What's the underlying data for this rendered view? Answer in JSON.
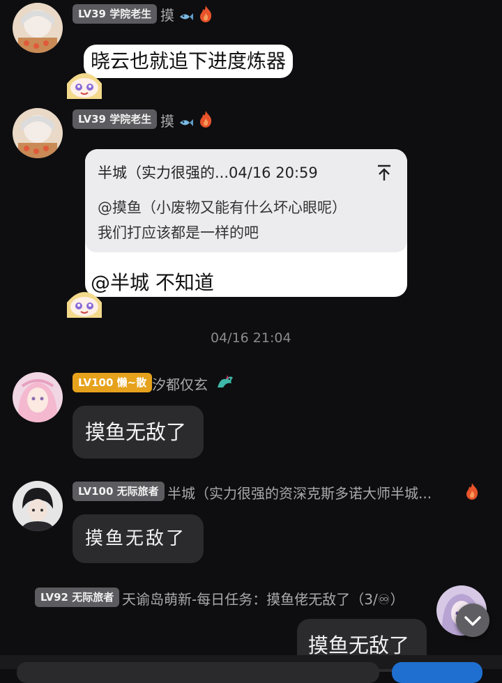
{
  "messages": [
    {
      "level_badge": "LV39 学院老生",
      "nickname": "摸",
      "text": "晓云也就追下进度炼器"
    },
    {
      "level_badge": "LV39 学院老生",
      "nickname": "摸",
      "quote": {
        "header": "半城（实力很强的...04/16 20:59",
        "line1": "@摸鱼（小废物又能有什么坏心眼呢）",
        "line2": "我们打应该都是一样的吧"
      },
      "text": "@半城 不知道"
    }
  ],
  "timestamp": "04/16 21:04",
  "messages2": [
    {
      "level_badge": "LV100 懒~散",
      "nickname": "汐都仅玄",
      "text": "摸鱼无敌了"
    },
    {
      "level_badge": "LV100 无际旅者",
      "nickname": "半城（实力很强的资深克斯多诺大师半城...",
      "text": "摸鱼无敌了"
    },
    {
      "level_badge": "LV92 无际旅者",
      "nickname": "天谕岛萌新-每日任务：摸鱼佬无敌了（3/♾）",
      "text": "摸鱼无敌了"
    }
  ],
  "colors": {
    "background": "#0e0e10",
    "gold_badge": "#e6a21c",
    "gray_badge": "#5b5b60",
    "fire": "#e8532b",
    "fish": "#7ab8e0"
  },
  "icons": [
    "fish-icon",
    "fire-icon",
    "quote-jump-icon",
    "scroll-down-icon"
  ]
}
